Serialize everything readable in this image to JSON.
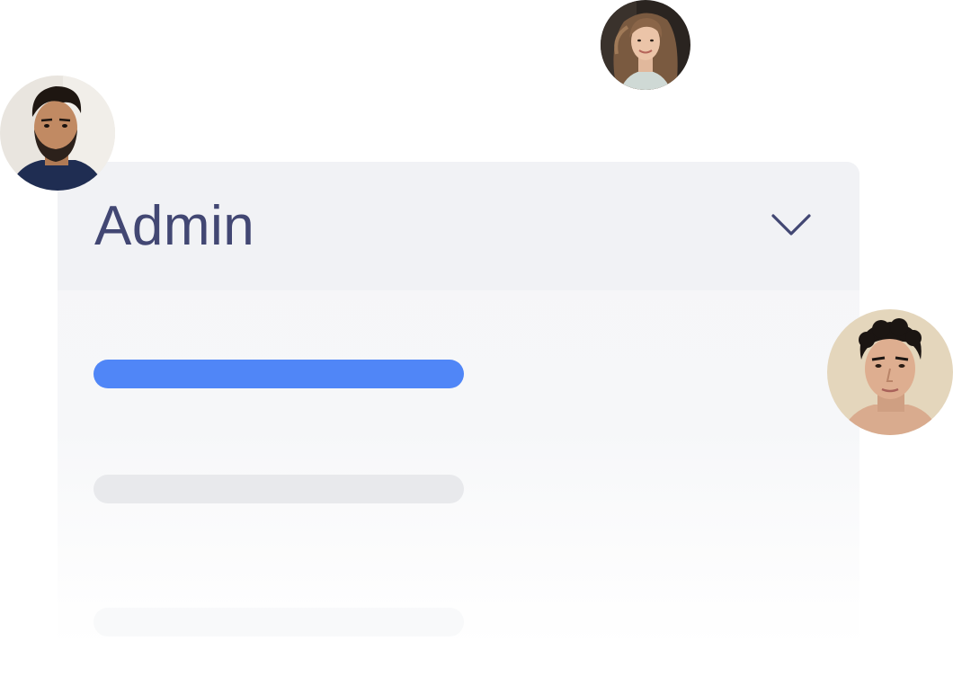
{
  "dropdown": {
    "selected_label": "Admin",
    "chevron_icon": "chevron-down-icon"
  },
  "options": [
    {
      "state": "active",
      "color": "#5086f7"
    },
    {
      "state": "inactive",
      "color": "#e8e9ec"
    },
    {
      "state": "faded",
      "color": "#f3f4f6"
    }
  ],
  "avatars": [
    {
      "icon": "user-avatar-bearded-man"
    },
    {
      "icon": "user-avatar-woman"
    },
    {
      "icon": "user-avatar-curly-hair-man"
    }
  ],
  "colors": {
    "accent": "#5086f7",
    "label_text": "#424773",
    "card_background": "#f1f2f5"
  }
}
